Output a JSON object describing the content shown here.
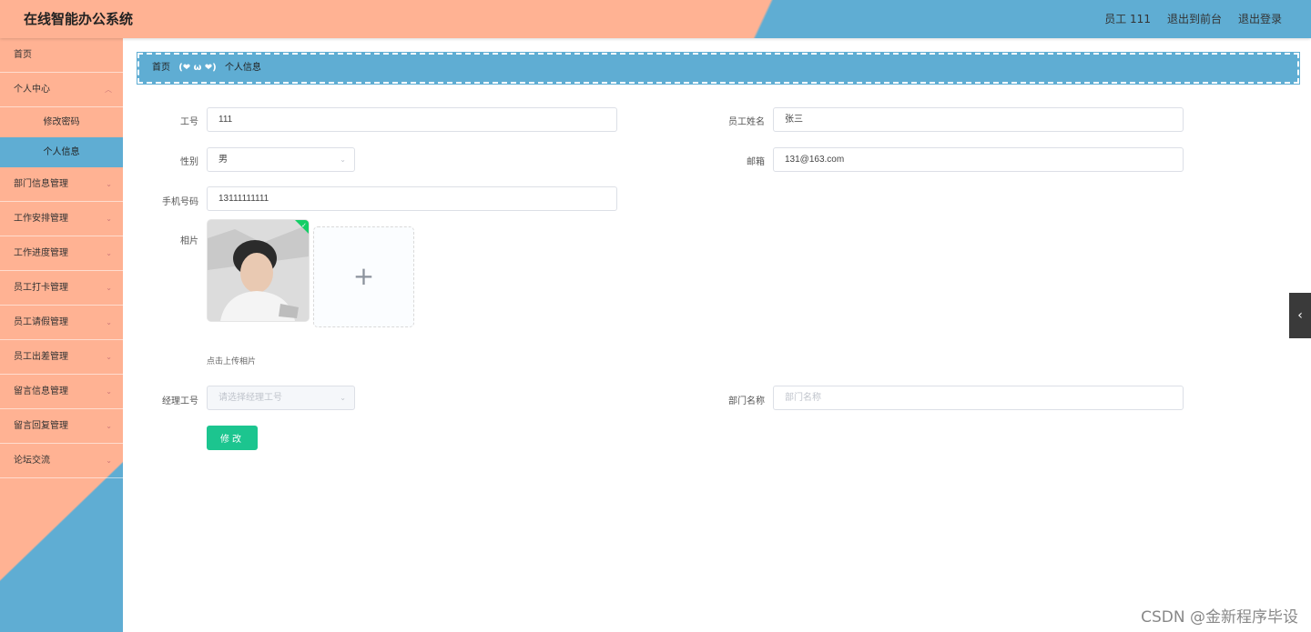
{
  "header": {
    "title": "在线智能办公系统",
    "user": "员工 111",
    "to_front": "退出到前台",
    "logout": "退出登录"
  },
  "sidebar": {
    "items": [
      {
        "label": "首页"
      },
      {
        "label": "个人中心",
        "chev": "⌄"
      },
      {
        "label": "修改密码"
      },
      {
        "label": "个人信息"
      },
      {
        "label": "部门信息管理",
        "chev": "⌄"
      },
      {
        "label": "工作安排管理",
        "chev": "⌄"
      },
      {
        "label": "工作进度管理",
        "chev": "⌄"
      },
      {
        "label": "员工打卡管理",
        "chev": "⌄"
      },
      {
        "label": "员工请假管理",
        "chev": "⌄"
      },
      {
        "label": "员工出差管理",
        "chev": "⌄"
      },
      {
        "label": "留言信息管理",
        "chev": "⌄"
      },
      {
        "label": "留言回复管理",
        "chev": "⌄"
      },
      {
        "label": "论坛交流",
        "chev": "⌄"
      }
    ]
  },
  "breadcrumb": {
    "home": "首页",
    "sep": "(❤ ω ❤)",
    "current": "个人信息"
  },
  "form": {
    "emp_no_label": "工号",
    "emp_no": "111",
    "emp_name_label": "员工姓名",
    "emp_name": "张三",
    "gender_label": "性别",
    "gender": "男",
    "email_label": "邮箱",
    "email": "131@163.com",
    "phone_label": "手机号码",
    "phone": "13111111111",
    "photo_label": "相片",
    "upload_tip": "点击上传相片",
    "upload_plus": "+",
    "manager_label": "经理工号",
    "manager_placeholder": "请选择经理工号",
    "dept_label": "部门名称",
    "dept_placeholder": "部门名称",
    "submit": "修改",
    "select_arrow": "⌄"
  },
  "side_toggle": "‹",
  "watermark": "CSDN @金新程序毕设"
}
